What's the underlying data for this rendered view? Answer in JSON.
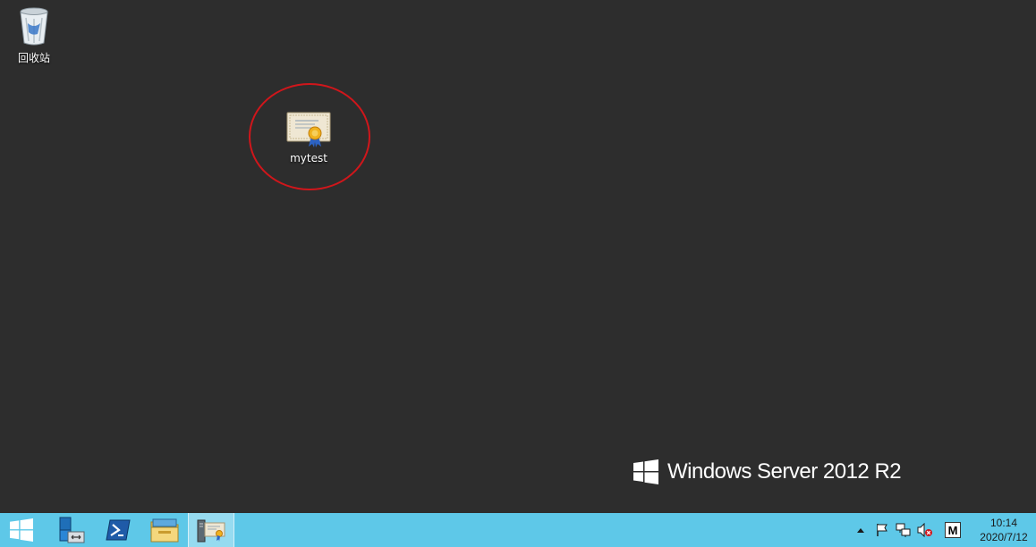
{
  "desktop": {
    "icons": [
      {
        "label": "回收站",
        "icon": "recycle-bin-icon"
      },
      {
        "label": "mytest",
        "icon": "certificate-icon"
      }
    ],
    "annotation_color": "#d0161b"
  },
  "branding": {
    "text": "Windows Server 2012 R2"
  },
  "taskbar": {
    "color": "#5ec8e8",
    "items": [
      {
        "name": "start-button",
        "icon": "windows-logo-icon"
      },
      {
        "name": "server-manager",
        "icon": "server-manager-icon"
      },
      {
        "name": "powershell",
        "icon": "powershell-icon"
      },
      {
        "name": "file-explorer",
        "icon": "folder-icon"
      },
      {
        "name": "certificate-viewer",
        "icon": "certificate-icon",
        "active": true
      }
    ],
    "tray": {
      "ime": "M",
      "time": "10:14",
      "date": "2020/7/12"
    }
  }
}
